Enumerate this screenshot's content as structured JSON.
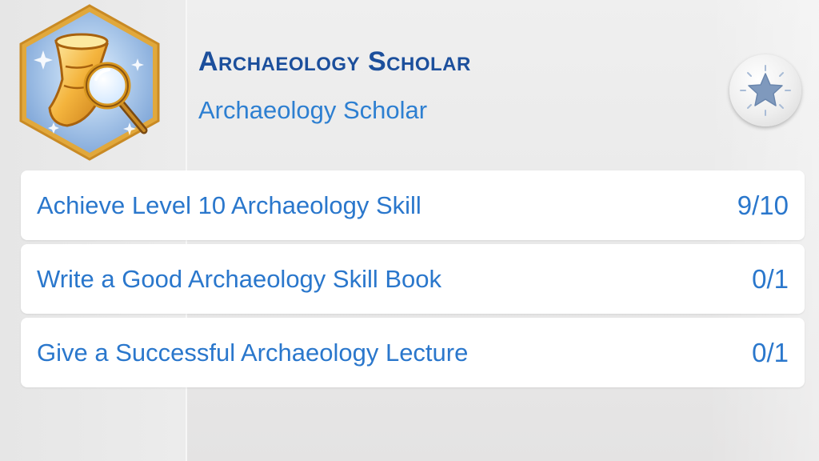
{
  "aspiration": {
    "title": "Archaeology Scholar",
    "subtitle": "Archaeology Scholar",
    "icon": "horn-with-magnifying-glass-icon",
    "button_icon": "star-icon"
  },
  "goals": [
    {
      "label": "Achieve Level 10 Archaeology Skill",
      "progress": "9/10"
    },
    {
      "label": "Write a Good Archaeology Skill Book",
      "progress": "0/1"
    },
    {
      "label": "Give a Successful Archaeology Lecture",
      "progress": "0/1"
    }
  ],
  "colors": {
    "title": "#1c4f9c",
    "text": "#2a77cc",
    "badge_border": "#e7b647",
    "badge_fill": "#a9c8ea"
  }
}
